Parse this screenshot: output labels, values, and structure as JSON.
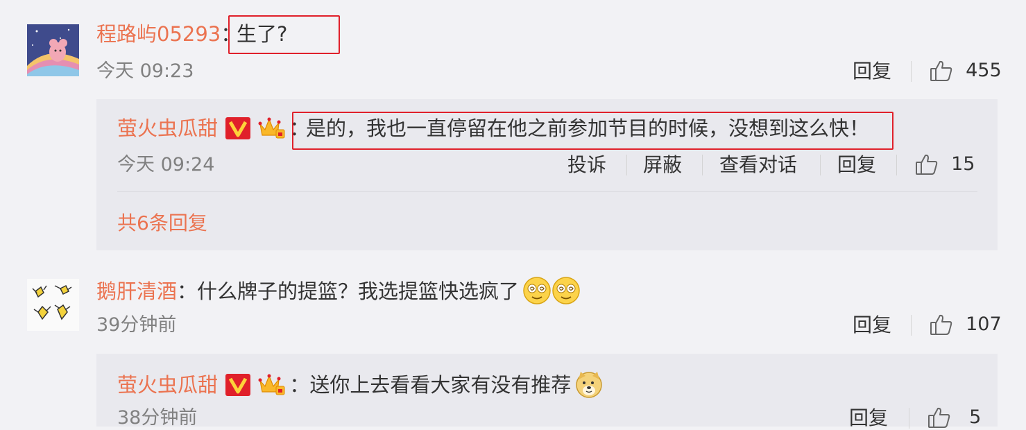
{
  "colors": {
    "name": "#eb7350",
    "highlight": "#e0202a",
    "reply_bg": "#e9e9ee",
    "page_bg": "#f2f2f5"
  },
  "comments": [
    {
      "author": "程路屿05293",
      "separator": "：",
      "text": "生了?",
      "time": "今天 09:23",
      "reply_label": "回复",
      "likes": "455",
      "replies": [
        {
          "author": "萤火虫瓜甜",
          "badges": [
            "v-badge-icon",
            "crown-icon"
          ],
          "separator": "：",
          "text": "是的，我也一直停留在他之前参加节目的时候，没想到这么快！",
          "time": "今天 09:24",
          "actions": [
            "投诉",
            "屏蔽",
            "查看对话",
            "回复"
          ],
          "likes": "15"
        }
      ],
      "more_replies": "共6条回复"
    },
    {
      "author": "鹅肝清酒",
      "separator": "：",
      "text": "什么牌子的提篮？我选提篮快选疯了",
      "emojis": [
        "dizzy-face-icon",
        "dizzy-face-icon"
      ],
      "time": "39分钟前",
      "reply_label": "回复",
      "likes": "107",
      "replies": [
        {
          "author": "萤火虫瓜甜",
          "badges": [
            "v-badge-icon",
            "crown-icon"
          ],
          "separator": "：",
          "text": "送你上去看看大家有没有推荐",
          "emojis": [
            "doge-icon"
          ],
          "time": "38分钟前",
          "reply_label": "回复",
          "likes": "5"
        }
      ]
    }
  ]
}
